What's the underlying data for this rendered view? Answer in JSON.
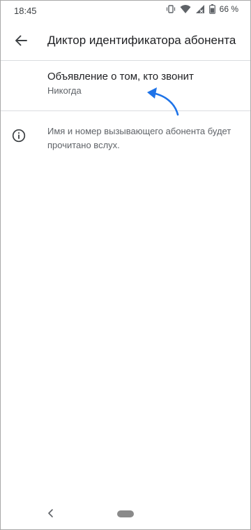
{
  "status_bar": {
    "time": "18:45",
    "battery_percent": "66 %",
    "icons": [
      "vibrate-icon",
      "wifi-icon",
      "signal-icon",
      "battery-icon"
    ]
  },
  "app_bar": {
    "title": "Диктор идентификатора абонента",
    "back_icon": "arrow-back-icon"
  },
  "preference": {
    "title": "Объявление о том, кто звонит",
    "summary": "Никогда"
  },
  "info": {
    "icon": "info-icon",
    "text": "Имя и номер вызывающего абонента будет прочитано вслух."
  },
  "annotation": {
    "color": "#1e73e8"
  },
  "nav_bar": {
    "back_icon": "nav-back-icon",
    "home_icon": "nav-home-pill"
  }
}
